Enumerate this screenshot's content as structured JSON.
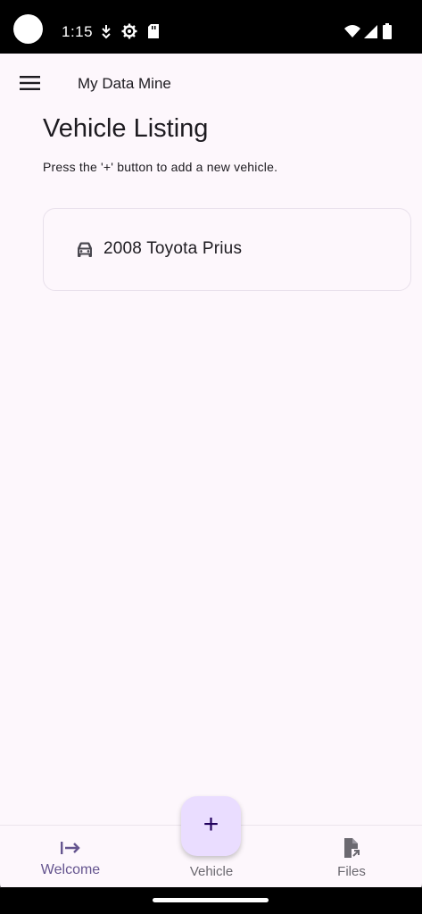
{
  "status_bar": {
    "time": "1:15",
    "icons": [
      "camera-cutout",
      "navigation-icon",
      "settings-gear-icon",
      "sd-card-icon",
      "wifi-icon",
      "cell-signal-icon",
      "battery-icon"
    ]
  },
  "app_bar": {
    "menu_icon": "hamburger-menu-icon",
    "title": "My Data Mine"
  },
  "page": {
    "title": "Vehicle Listing",
    "subtitle": "Press the '+' button to add a new vehicle."
  },
  "vehicles": [
    {
      "icon": "car-icon",
      "name": "2008 Toyota Prius"
    }
  ],
  "fab": {
    "label": "+",
    "icon": "add-icon"
  },
  "bottom_nav": {
    "items": [
      {
        "label": "Welcome",
        "icon": "login-arrow-icon",
        "active": true
      },
      {
        "label": "Vehicle",
        "icon": "",
        "active": false
      },
      {
        "label": "Files",
        "icon": "file-open-icon",
        "active": false
      }
    ]
  },
  "colors": {
    "background": "#fdf7fc",
    "accent": "#65558f",
    "fab_bg": "#eaddff",
    "text": "#1d1b20",
    "muted": "#6b6970"
  }
}
